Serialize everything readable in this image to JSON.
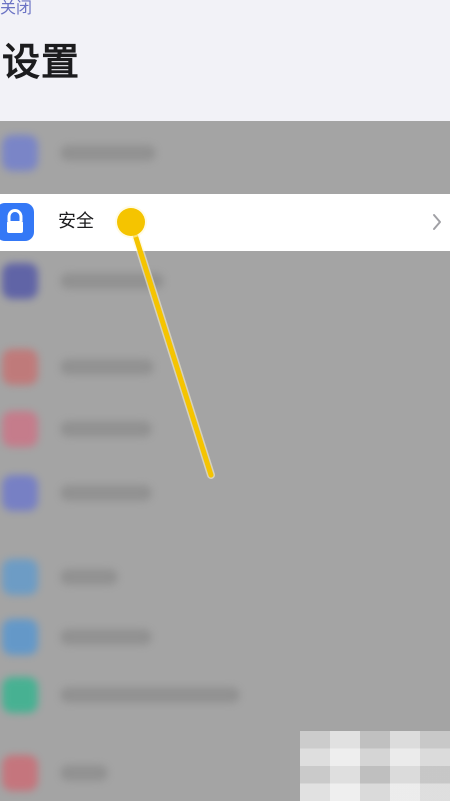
{
  "header": {
    "close_label": "关闭",
    "title": "设置"
  },
  "security_row": {
    "label": "安全",
    "icon": "lock-icon",
    "chevron_icon": "chevron-right-icon",
    "icon_color": "#3478f6"
  },
  "blurred_rows": [
    {
      "icon": "blurred-icon",
      "icon_color": "#6c7bd3"
    },
    {
      "icon": "blurred-icon",
      "icon_color": "#4a4fa7"
    },
    {
      "icon": "blurred-icon",
      "icon_color": "#c96d6d"
    },
    {
      "icon": "blurred-icon",
      "icon_color": "#d06f83"
    },
    {
      "icon": "blurred-icon",
      "icon_color": "#6874cf"
    },
    {
      "icon": "blurred-icon",
      "icon_color": "#5b9ad0"
    },
    {
      "icon": "blurred-icon",
      "icon_color": "#4f95d5"
    },
    {
      "icon": "blurred-icon",
      "icon_color": "#29b68d"
    },
    {
      "icon": "blurred-icon",
      "icon_color": "#d06670"
    }
  ],
  "pointer": {
    "icon": "tap-pointer-icon",
    "color": "#f5c400"
  }
}
